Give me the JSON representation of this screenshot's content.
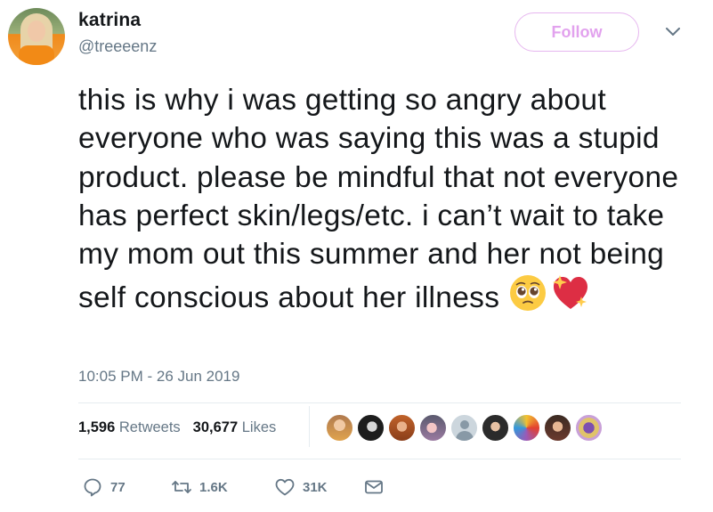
{
  "user": {
    "display_name": "katrina",
    "handle": "@treeeenz",
    "follow_label": "Follow"
  },
  "tweet": {
    "text": "this is why i was getting so angry about everyone who was saying this was a stupid product. please be mindful that not everyone has perfect skin/legs/etc. i can’t wait to take my mom out this summer and her not being self conscious about her illness",
    "emojis": [
      "pleading-face-icon",
      "sparkling-heart-icon"
    ],
    "timestamp": "10:05 PM - 26 Jun 2019"
  },
  "stats": {
    "retweets_count": "1,596",
    "retweets_label": "Retweets",
    "likes_count": "30,677",
    "likes_label": "Likes"
  },
  "actions": {
    "reply_count": "77",
    "retweet_count": "1.6K",
    "like_count": "31K"
  },
  "colors": {
    "follow_accent": "#e2a2ee",
    "secondary_text": "#657786",
    "divider": "#e6ecf0"
  }
}
